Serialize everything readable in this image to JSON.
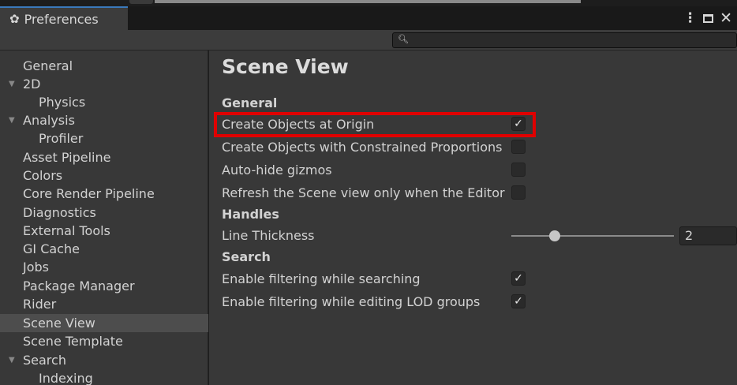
{
  "window": {
    "tab_title": "Preferences",
    "tab_icon": "gear-icon",
    "controls": {
      "menu_glyph": "⋮",
      "close_glyph": "✕"
    }
  },
  "search": {
    "value": "",
    "icon": "search-icon"
  },
  "sidebar": {
    "items": [
      {
        "label": "General",
        "expanded": null
      },
      {
        "label": "2D",
        "expanded": true
      },
      {
        "label": "Physics",
        "expanded": null
      },
      {
        "label": "Analysis",
        "expanded": true
      },
      {
        "label": "Profiler",
        "expanded": null
      },
      {
        "label": "Asset Pipeline",
        "expanded": null
      },
      {
        "label": "Colors",
        "expanded": null
      },
      {
        "label": "Core Render Pipeline",
        "expanded": null
      },
      {
        "label": "Diagnostics",
        "expanded": null
      },
      {
        "label": "External Tools",
        "expanded": null
      },
      {
        "label": "GI Cache",
        "expanded": null
      },
      {
        "label": "Jobs",
        "expanded": null
      },
      {
        "label": "Package Manager",
        "expanded": null
      },
      {
        "label": "Rider",
        "expanded": null
      },
      {
        "label": "Scene View",
        "expanded": null,
        "selected": true
      },
      {
        "label": "Scene Template",
        "expanded": null
      },
      {
        "label": "Search",
        "expanded": true
      },
      {
        "label": "Indexing",
        "expanded": null
      }
    ]
  },
  "content": {
    "title": "Scene View",
    "sections": {
      "general": "General",
      "handles": "Handles",
      "search": "Search"
    },
    "options": {
      "create_at_origin": {
        "label": "Create Objects at Origin",
        "checked": true
      },
      "constrained_proportions": {
        "label": "Create Objects with Constrained Proportions",
        "checked": false
      },
      "auto_hide_gizmos": {
        "label": "Auto-hide gizmos",
        "checked": false
      },
      "refresh_scene_view": {
        "label": "Refresh the Scene view only when the Editor",
        "checked": false
      },
      "line_thickness": {
        "label": "Line Thickness",
        "value": "2",
        "slider_fraction": 0.25
      },
      "filter_searching": {
        "label": "Enable filtering while searching",
        "checked": true
      },
      "filter_lod": {
        "label": "Enable filtering while editing LOD groups",
        "checked": true
      }
    },
    "check_glyph": "✓",
    "highlight_color": "#e00000"
  }
}
